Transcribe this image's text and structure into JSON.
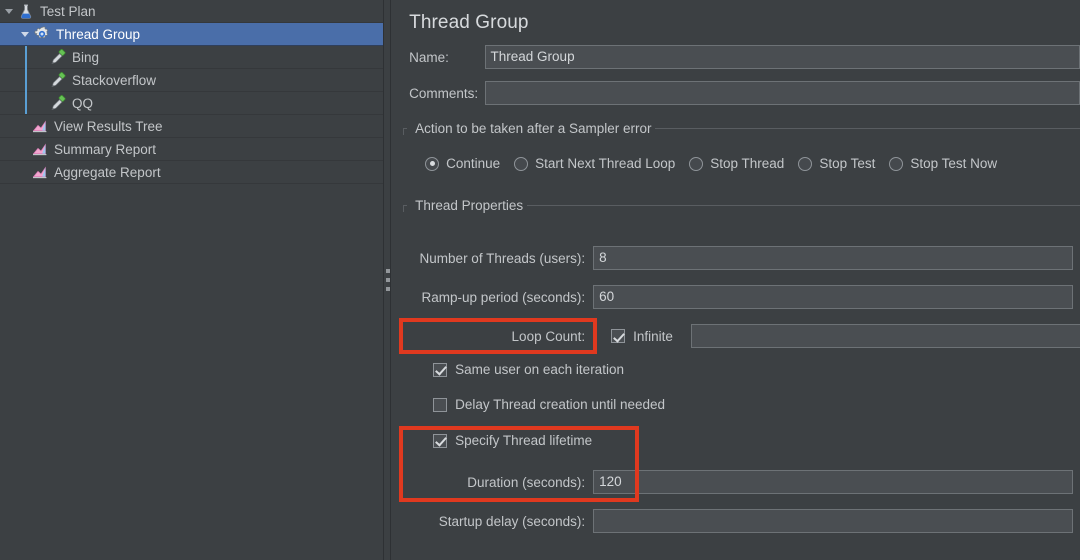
{
  "app": {
    "accent_blue": "#4a6ea9",
    "highlight_red": "#e0391f",
    "background": "#3c4043"
  },
  "tree": {
    "items": [
      {
        "label": "Test Plan",
        "icon": "test-plan-flask-icon",
        "indent": 0,
        "twisty": "expanded",
        "selected": false
      },
      {
        "label": "Thread Group",
        "icon": "thread-group-gear-icon",
        "indent": 1,
        "twisty": "expanded",
        "selected": true
      },
      {
        "label": "Bing",
        "icon": "http-sampler-dropper-icon",
        "indent": 2,
        "twisty": "none",
        "selected": false
      },
      {
        "label": "Stackoverflow",
        "icon": "http-sampler-dropper-icon",
        "indent": 2,
        "twisty": "none",
        "selected": false
      },
      {
        "label": "QQ",
        "icon": "http-sampler-dropper-icon",
        "indent": 2,
        "twisty": "none",
        "selected": false
      },
      {
        "label": "View Results Tree",
        "icon": "listener-chart-icon",
        "indent": 1,
        "twisty": "none",
        "selected": false
      },
      {
        "label": "Summary Report",
        "icon": "listener-chart-icon",
        "indent": 1,
        "twisty": "none",
        "selected": false
      },
      {
        "label": "Aggregate Report",
        "icon": "listener-chart-icon",
        "indent": 1,
        "twisty": "none",
        "selected": false
      }
    ]
  },
  "detail": {
    "title": "Thread Group",
    "name": {
      "label": "Name:",
      "value": "Thread Group",
      "placeholder": ""
    },
    "comments": {
      "label": "Comments:",
      "value": "",
      "placeholder": ""
    },
    "sampler_error": {
      "group_title": "Action to be taken after a Sampler error",
      "options": [
        {
          "label": "Continue",
          "selected": true
        },
        {
          "label": "Start Next Thread Loop",
          "selected": false
        },
        {
          "label": "Stop Thread",
          "selected": false
        },
        {
          "label": "Stop Test",
          "selected": false
        },
        {
          "label": "Stop Test Now",
          "selected": false
        }
      ]
    },
    "thread_properties": {
      "group_title": "Thread Properties",
      "num_threads": {
        "label": "Number of Threads (users):",
        "value": "8"
      },
      "ramp_up": {
        "label": "Ramp-up period (seconds):",
        "value": "60"
      },
      "loop_count": {
        "label": "Loop Count:",
        "infinite_label": "Infinite",
        "infinite_checked": true,
        "value": ""
      },
      "same_user": {
        "label": "Same user on each iteration",
        "checked": true
      },
      "delay_thread": {
        "label": "Delay Thread creation until needed",
        "checked": false
      },
      "specify_lifetime": {
        "label": "Specify Thread lifetime",
        "checked": true
      },
      "duration": {
        "label": "Duration (seconds):",
        "value": "120"
      },
      "startup_delay": {
        "label": "Startup delay (seconds):",
        "value": ""
      }
    }
  }
}
